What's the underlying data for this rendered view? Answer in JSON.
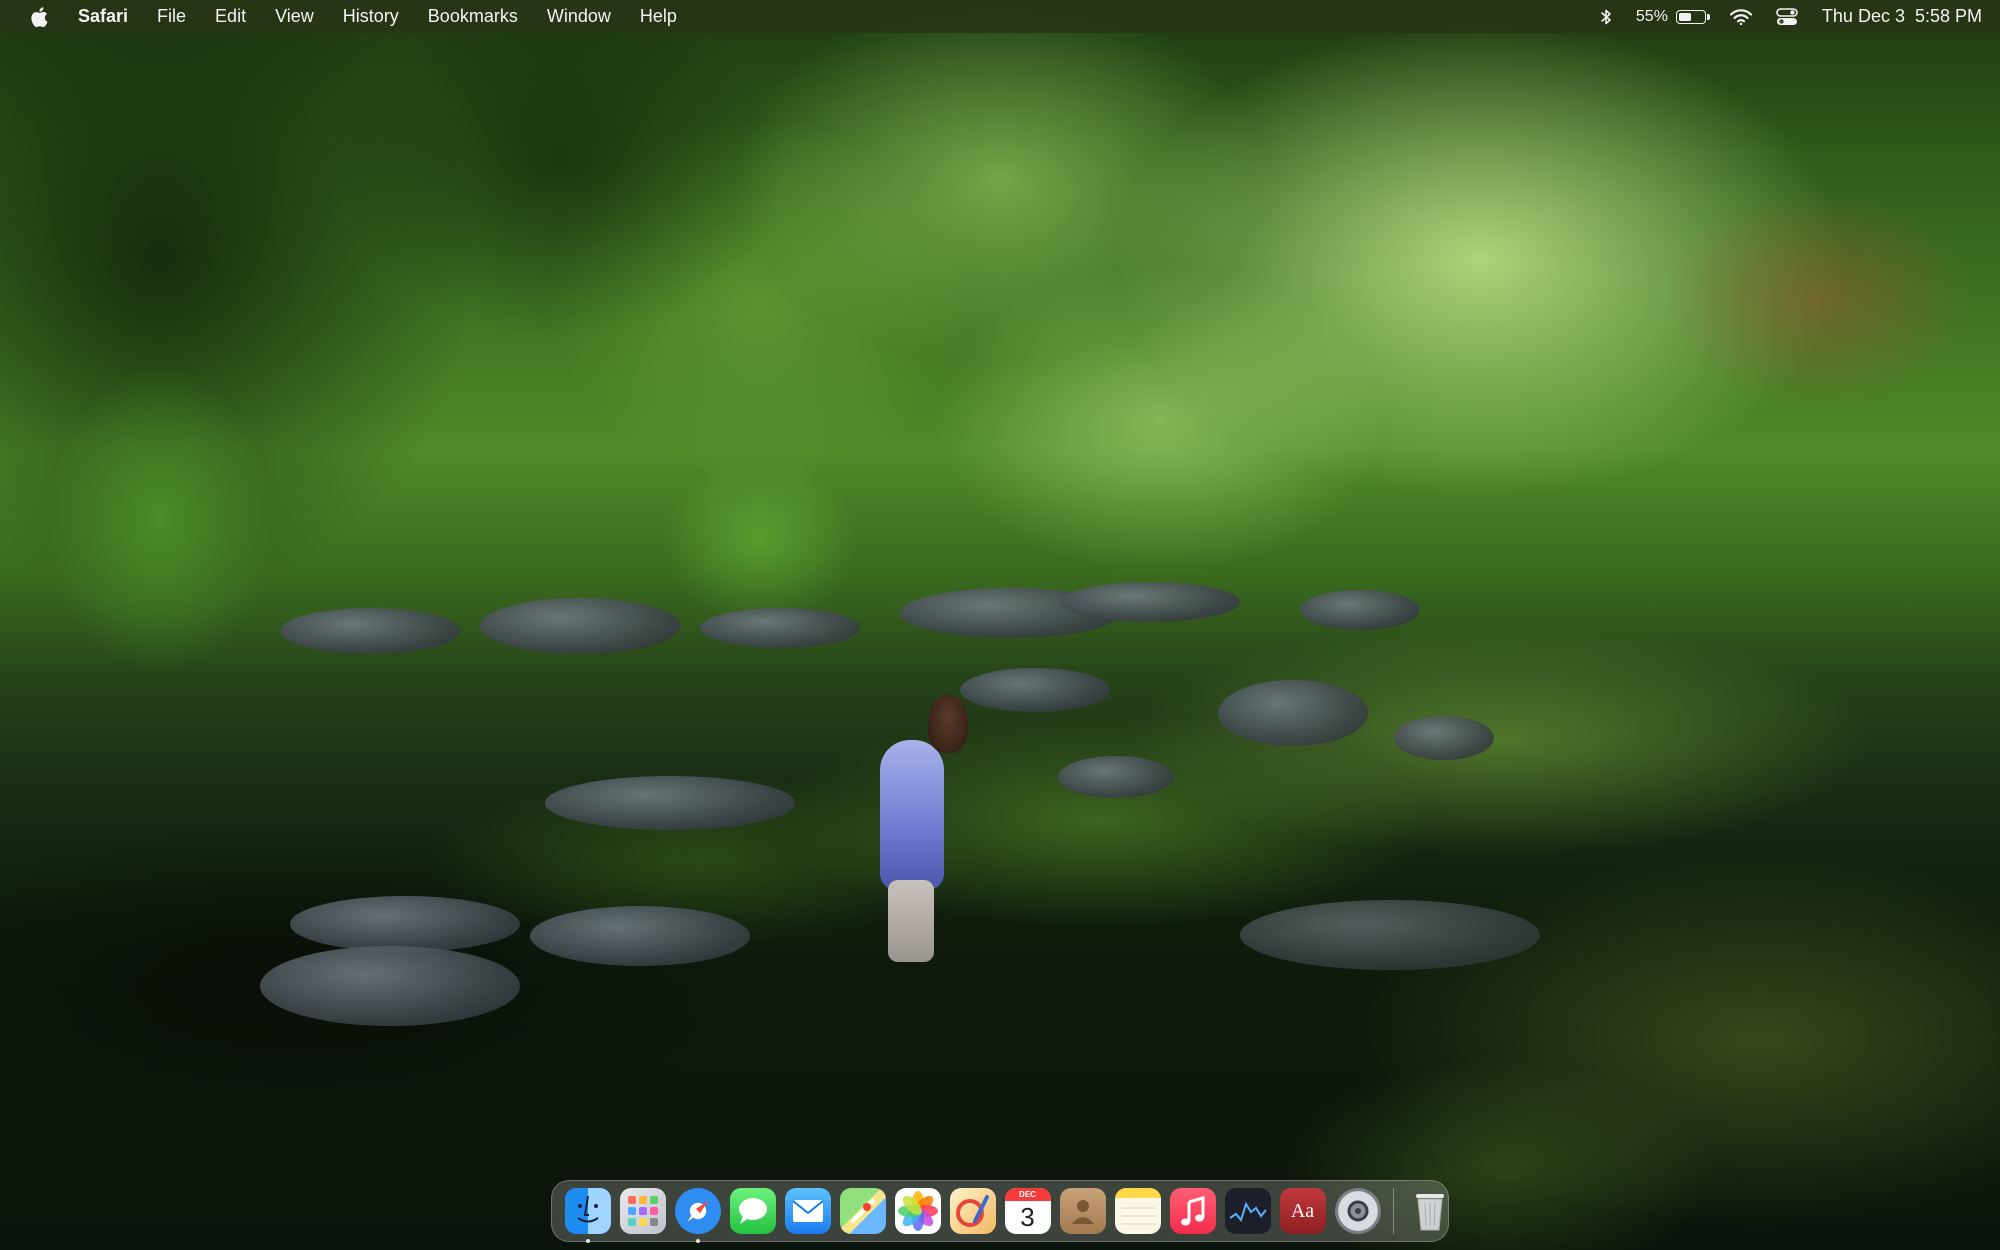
{
  "menubar": {
    "app_name": "Safari",
    "menus": [
      "File",
      "Edit",
      "View",
      "History",
      "Bookmarks",
      "Window",
      "Help"
    ],
    "battery_percent": "55%",
    "battery_level": 0.55,
    "clock": "Thu Dec 3  5:58 PM"
  },
  "dock": {
    "apps": [
      {
        "name": "Finder",
        "icon": "finder-icon",
        "running": true
      },
      {
        "name": "Launchpad",
        "icon": "launchpad-icon",
        "running": false
      },
      {
        "name": "Safari",
        "icon": "safari-icon",
        "running": true
      },
      {
        "name": "Messages",
        "icon": "messages-icon",
        "running": false
      },
      {
        "name": "Mail",
        "icon": "mail-icon",
        "running": false
      },
      {
        "name": "Maps",
        "icon": "maps-icon",
        "running": false
      },
      {
        "name": "Photos",
        "icon": "photos-icon",
        "running": false
      },
      {
        "name": "Pixelmator",
        "icon": "pixelmator-icon",
        "running": false
      },
      {
        "name": "Calendar",
        "icon": "calendar-icon",
        "running": false,
        "month": "DEC",
        "day": "3"
      },
      {
        "name": "Contacts",
        "icon": "contacts-icon",
        "running": false
      },
      {
        "name": "Notes",
        "icon": "notes-icon",
        "running": false
      },
      {
        "name": "Music",
        "icon": "music-icon",
        "running": false
      },
      {
        "name": "Stocks",
        "icon": "stocks-icon",
        "running": false
      },
      {
        "name": "Dictionary",
        "icon": "dictionary-icon",
        "running": false,
        "glyph": "Aa"
      },
      {
        "name": "System Preferences",
        "icon": "system-preferences-icon",
        "running": false
      }
    ],
    "trash": {
      "name": "Trash",
      "icon": "trash-icon"
    }
  }
}
